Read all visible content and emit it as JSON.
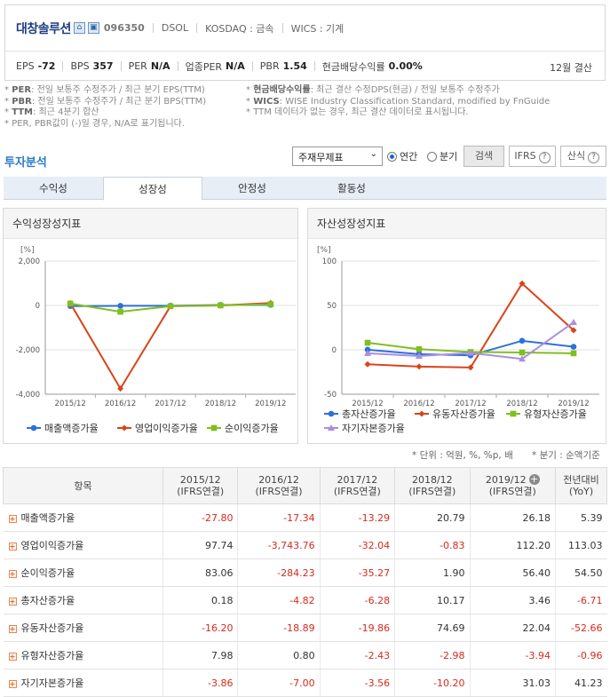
{
  "company": {
    "name": "대창솔루션",
    "code": "096350",
    "abbr": "DSOL",
    "market": "KOSDAQ : 금속",
    "wics": "WICS : 기계",
    "fiscal": "12월 결산"
  },
  "metrics": [
    {
      "key": "EPS",
      "value": "-72"
    },
    {
      "key": "BPS",
      "value": "357"
    },
    {
      "key": "PER",
      "value": "N/A"
    },
    {
      "key": "업종PER",
      "value": "N/A"
    },
    {
      "key": "PBR",
      "value": "1.54"
    },
    {
      "key": "현금배당수익률",
      "value": "0.00%"
    }
  ],
  "notes": {
    "left": [
      {
        "b": "PER",
        "t": ": 전일 보통주 수정주가 / 최근 분기 EPS(TTM)"
      },
      {
        "b": "PBR",
        "t": ": 전일 보통주 수정주가 / 최근 분기 BPS(TTM)"
      },
      {
        "b": "TTM",
        "t": ": 최근 4분기 합산"
      },
      {
        "b": "",
        "t": "PER, PBR값이 (-)일 경우, N/A로 표기됩니다."
      }
    ],
    "right": [
      {
        "b": "현금배당수익률",
        "t": ": 최근 결산 수정DPS(현금) / 전일 보통주 수정주가"
      },
      {
        "b": "WICS",
        "t": ": WISE Industry Classification Standard, modified by FnGuide"
      },
      {
        "b": "",
        "t": "TTM 데이터가 없는 경우, 최근 결산 데이터로 표시됩니다."
      }
    ]
  },
  "section_title": "투자분석",
  "controls": {
    "select_value": "주재무제표",
    "radio_annual": "연간",
    "radio_quarter": "분기",
    "search": "검색",
    "ifrs": "IFRS",
    "formula": "산식"
  },
  "tabs": [
    "수익성",
    "성장성",
    "안정성",
    "활동성"
  ],
  "active_tab": 1,
  "panels": {
    "left_title": "수익성장성지표",
    "right_title": "자산성장성지표",
    "unit": "[%]"
  },
  "colors": {
    "blue": "#2f6fdb",
    "orange": "#d9441a",
    "green": "#7fbf1f",
    "purple": "#a98ee0",
    "negative": "#d52b1e",
    "accent": "#2a7bc9"
  },
  "chart_data": [
    {
      "type": "line",
      "title": "수익성장성지표",
      "ylabel": "[%]",
      "categories": [
        "2015/12",
        "2016/12",
        "2017/12",
        "2018/12",
        "2019/12"
      ],
      "yticks": [
        "2,000",
        "0",
        "-2,000",
        "-4,000"
      ],
      "ylim": [
        -4000,
        2000
      ],
      "series": [
        {
          "name": "매출액증가율",
          "color": "blue",
          "values": [
            -27.8,
            -17.34,
            -13.29,
            20.79,
            26.18
          ]
        },
        {
          "name": "영업이익증가율",
          "color": "orange",
          "values": [
            97.74,
            -3743.76,
            -32.04,
            -0.83,
            112.2
          ]
        },
        {
          "name": "순이익증가율",
          "color": "green",
          "values": [
            83.06,
            -284.23,
            -35.27,
            1.9,
            56.4
          ]
        }
      ]
    },
    {
      "type": "line",
      "title": "자산성장성지표",
      "ylabel": "[%]",
      "categories": [
        "2015/12",
        "2016/12",
        "2017/12",
        "2018/12",
        "2019/12"
      ],
      "yticks": [
        "100",
        "50",
        "0",
        "-50"
      ],
      "ylim": [
        -50,
        100
      ],
      "series": [
        {
          "name": "총자산증가율",
          "color": "blue",
          "values": [
            0.18,
            -4.82,
            -6.28,
            10.17,
            3.46
          ]
        },
        {
          "name": "유동자산증가율",
          "color": "orange",
          "values": [
            -16.2,
            -18.89,
            -19.86,
            74.69,
            22.04
          ]
        },
        {
          "name": "유형자산증가율",
          "color": "green",
          "values": [
            7.98,
            0.8,
            -2.43,
            -2.98,
            -3.94
          ]
        },
        {
          "name": "자기자본증가율",
          "color": "purple",
          "values": [
            -3.86,
            -7.0,
            -3.56,
            -10.2,
            31.03
          ]
        }
      ]
    }
  ],
  "table": {
    "unit_note": "* 단위 : 억원, %, %p, 배",
    "period_note": "* 분기 : 순액기준",
    "item_header": "항목",
    "columns": [
      {
        "period": "2015/12",
        "basis": "(IFRS연결)"
      },
      {
        "period": "2016/12",
        "basis": "(IFRS연결)"
      },
      {
        "period": "2017/12",
        "basis": "(IFRS연결)"
      },
      {
        "period": "2018/12",
        "basis": "(IFRS연결)"
      },
      {
        "period": "2019/12",
        "basis": "(IFRS연결)"
      },
      {
        "period": "전년대비",
        "basis": "(YoY)"
      }
    ],
    "rows": [
      {
        "label": "매출액증가율",
        "cells": [
          "-27.80",
          "-17.34",
          "-13.29",
          "20.79",
          "26.18",
          "5.39"
        ]
      },
      {
        "label": "영업이익증가율",
        "cells": [
          "97.74",
          "-3,743.76",
          "-32.04",
          "-0.83",
          "112.20",
          "113.03"
        ]
      },
      {
        "label": "순이익증가율",
        "cells": [
          "83.06",
          "-284.23",
          "-35.27",
          "1.90",
          "56.40",
          "54.50"
        ]
      },
      {
        "label": "총자산증가율",
        "cells": [
          "0.18",
          "-4.82",
          "-6.28",
          "10.17",
          "3.46",
          "-6.71"
        ]
      },
      {
        "label": "유동자산증가율",
        "cells": [
          "-16.20",
          "-18.89",
          "-19.86",
          "74.69",
          "22.04",
          "-52.66"
        ]
      },
      {
        "label": "유형자산증가율",
        "cells": [
          "7.98",
          "0.80",
          "-2.43",
          "-2.98",
          "-3.94",
          "-0.96"
        ]
      },
      {
        "label": "자기자본증가율",
        "cells": [
          "-3.86",
          "-7.00",
          "-3.56",
          "-10.20",
          "31.03",
          "41.23"
        ]
      }
    ]
  }
}
